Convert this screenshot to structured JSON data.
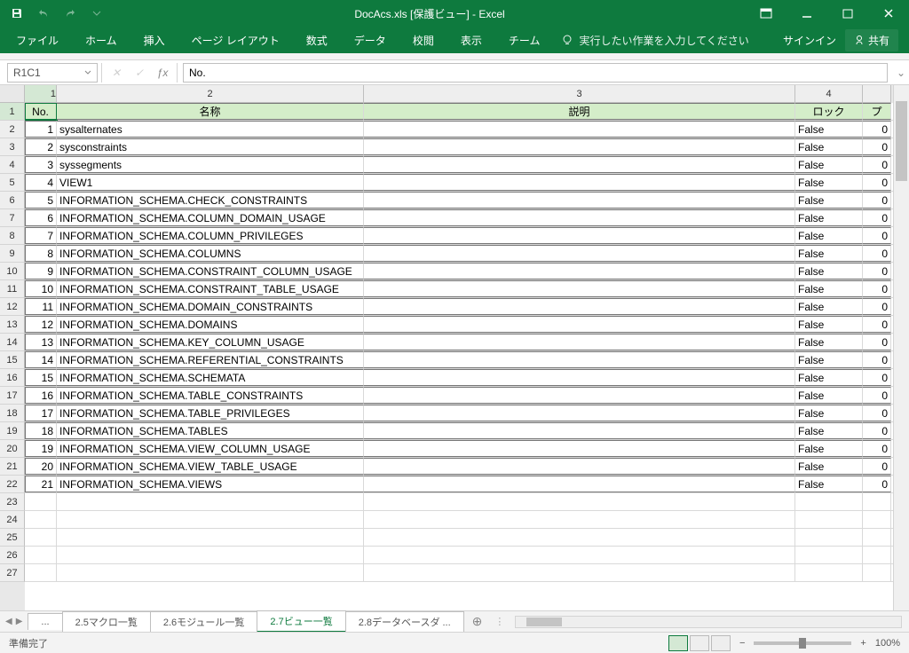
{
  "title": "DocAcs.xls [保護ビュー] - Excel",
  "qat": {
    "undo": "↶",
    "redo": "↷"
  },
  "tabs": {
    "file": "ファイル",
    "home": "ホーム",
    "insert": "挿入",
    "page": "ページ レイアウト",
    "formulas": "数式",
    "data": "データ",
    "review": "校閲",
    "view": "表示",
    "team": "チーム"
  },
  "tellme": "実行したい作業を入力してください",
  "signin": "サインイン",
  "share": "共有",
  "namebox": "R1C1",
  "formula": "No.",
  "col_headers": [
    "1",
    "2",
    "3",
    "4",
    ""
  ],
  "table_header": {
    "no": "No.",
    "name": "名称",
    "desc": "説明",
    "lock": "ロック",
    "prop": "プ"
  },
  "rows": [
    {
      "n": "1",
      "name": "sysalternates",
      "desc": "",
      "lock": "False",
      "p": "0"
    },
    {
      "n": "2",
      "name": "sysconstraints",
      "desc": "",
      "lock": "False",
      "p": "0"
    },
    {
      "n": "3",
      "name": "syssegments",
      "desc": "",
      "lock": "False",
      "p": "0"
    },
    {
      "n": "4",
      "name": "VIEW1",
      "desc": "",
      "lock": "False",
      "p": "0"
    },
    {
      "n": "5",
      "name": "INFORMATION_SCHEMA.CHECK_CONSTRAINTS",
      "desc": "",
      "lock": "False",
      "p": "0"
    },
    {
      "n": "6",
      "name": "INFORMATION_SCHEMA.COLUMN_DOMAIN_USAGE",
      "desc": "",
      "lock": "False",
      "p": "0"
    },
    {
      "n": "7",
      "name": "INFORMATION_SCHEMA.COLUMN_PRIVILEGES",
      "desc": "",
      "lock": "False",
      "p": "0"
    },
    {
      "n": "8",
      "name": "INFORMATION_SCHEMA.COLUMNS",
      "desc": "",
      "lock": "False",
      "p": "0"
    },
    {
      "n": "9",
      "name": "INFORMATION_SCHEMA.CONSTRAINT_COLUMN_USAGE",
      "desc": "",
      "lock": "False",
      "p": "0"
    },
    {
      "n": "10",
      "name": "INFORMATION_SCHEMA.CONSTRAINT_TABLE_USAGE",
      "desc": "",
      "lock": "False",
      "p": "0"
    },
    {
      "n": "11",
      "name": "INFORMATION_SCHEMA.DOMAIN_CONSTRAINTS",
      "desc": "",
      "lock": "False",
      "p": "0"
    },
    {
      "n": "12",
      "name": "INFORMATION_SCHEMA.DOMAINS",
      "desc": "",
      "lock": "False",
      "p": "0"
    },
    {
      "n": "13",
      "name": "INFORMATION_SCHEMA.KEY_COLUMN_USAGE",
      "desc": "",
      "lock": "False",
      "p": "0"
    },
    {
      "n": "14",
      "name": "INFORMATION_SCHEMA.REFERENTIAL_CONSTRAINTS",
      "desc": "",
      "lock": "False",
      "p": "0"
    },
    {
      "n": "15",
      "name": "INFORMATION_SCHEMA.SCHEMATA",
      "desc": "",
      "lock": "False",
      "p": "0"
    },
    {
      "n": "16",
      "name": "INFORMATION_SCHEMA.TABLE_CONSTRAINTS",
      "desc": "",
      "lock": "False",
      "p": "0"
    },
    {
      "n": "17",
      "name": "INFORMATION_SCHEMA.TABLE_PRIVILEGES",
      "desc": "",
      "lock": "False",
      "p": "0"
    },
    {
      "n": "18",
      "name": "INFORMATION_SCHEMA.TABLES",
      "desc": "",
      "lock": "False",
      "p": "0"
    },
    {
      "n": "19",
      "name": "INFORMATION_SCHEMA.VIEW_COLUMN_USAGE",
      "desc": "",
      "lock": "False",
      "p": "0"
    },
    {
      "n": "20",
      "name": "INFORMATION_SCHEMA.VIEW_TABLE_USAGE",
      "desc": "",
      "lock": "False",
      "p": "0"
    },
    {
      "n": "21",
      "name": "INFORMATION_SCHEMA.VIEWS",
      "desc": "",
      "lock": "False",
      "p": "0"
    }
  ],
  "sheets": {
    "ellipsis": "...",
    "s1": "2.5マクロ一覧",
    "s2": "2.6モジュール一覧",
    "s3": "2.7ビュー一覧",
    "s4": "2.8データベースダ ..."
  },
  "status": "準備完了",
  "zoom": "100%"
}
